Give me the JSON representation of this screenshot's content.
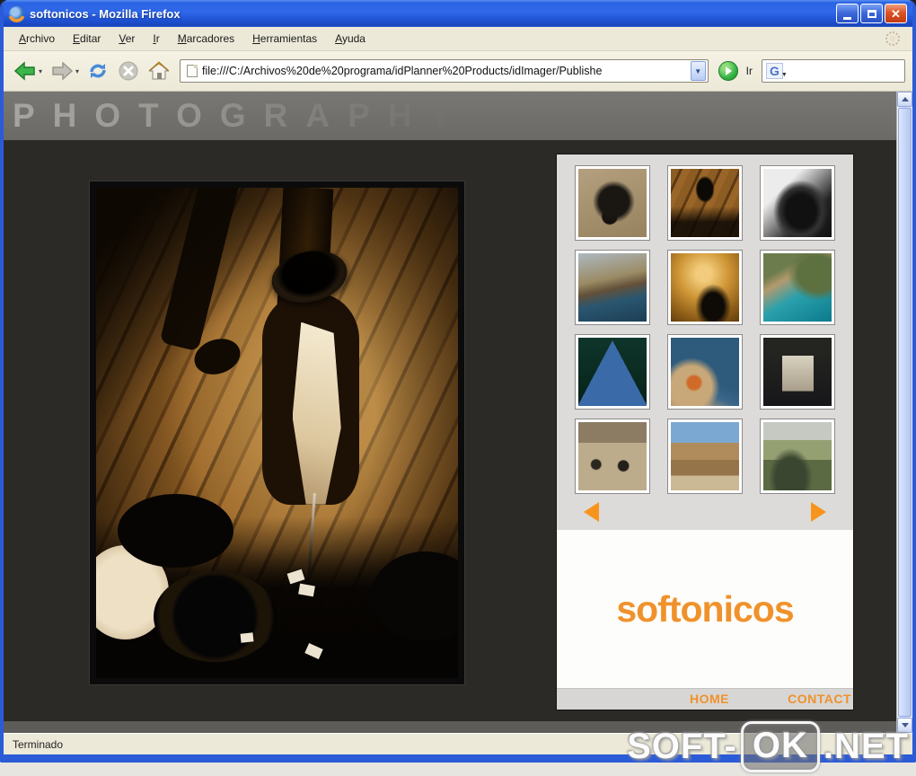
{
  "window": {
    "title": "softonicos - Mozilla Firefox"
  },
  "menu": {
    "items": [
      "Archivo",
      "Editar",
      "Ver",
      "Ir",
      "Marcadores",
      "Herramientas",
      "Ayuda"
    ]
  },
  "toolbar": {
    "address": {
      "value": "file:///C:/Archivos%20de%20programa/idPlanner%20Products/idImager/Publishe"
    },
    "go_label": "Ir",
    "search": {
      "value": "",
      "engine_letter": "G"
    }
  },
  "page": {
    "header_title": "PHOTOGRAPHY",
    "main_photo_subject": "sepia western saloon scene: gunman in black hat standing over card players on wooden plank floor",
    "gallery": {
      "thumbnails": [
        {
          "subject": "black dog on stone pavement"
        },
        {
          "subject": "western saloon scene"
        },
        {
          "subject": "black car, black and white"
        },
        {
          "subject": "rocky coastline with water"
        },
        {
          "subject": "golden sunset over water with silhouette"
        },
        {
          "subject": "turquoise cove with cliffs and trees"
        },
        {
          "subject": "boat bow over green water"
        },
        {
          "subject": "boat deck on blue sea"
        },
        {
          "subject": "window with open shutters"
        },
        {
          "subject": "people walking on a plaza"
        },
        {
          "subject": "western town buildings under blue sky"
        },
        {
          "subject": "landscape view from a terrace"
        }
      ]
    },
    "logo": "softonicos",
    "footer": {
      "home": "HOME",
      "contact": "CONTACT"
    }
  },
  "statusbar": {
    "text": "Terminado"
  },
  "watermark": {
    "prefix": "SOFT-",
    "middle": "OK",
    "suffix": ".NET"
  }
}
